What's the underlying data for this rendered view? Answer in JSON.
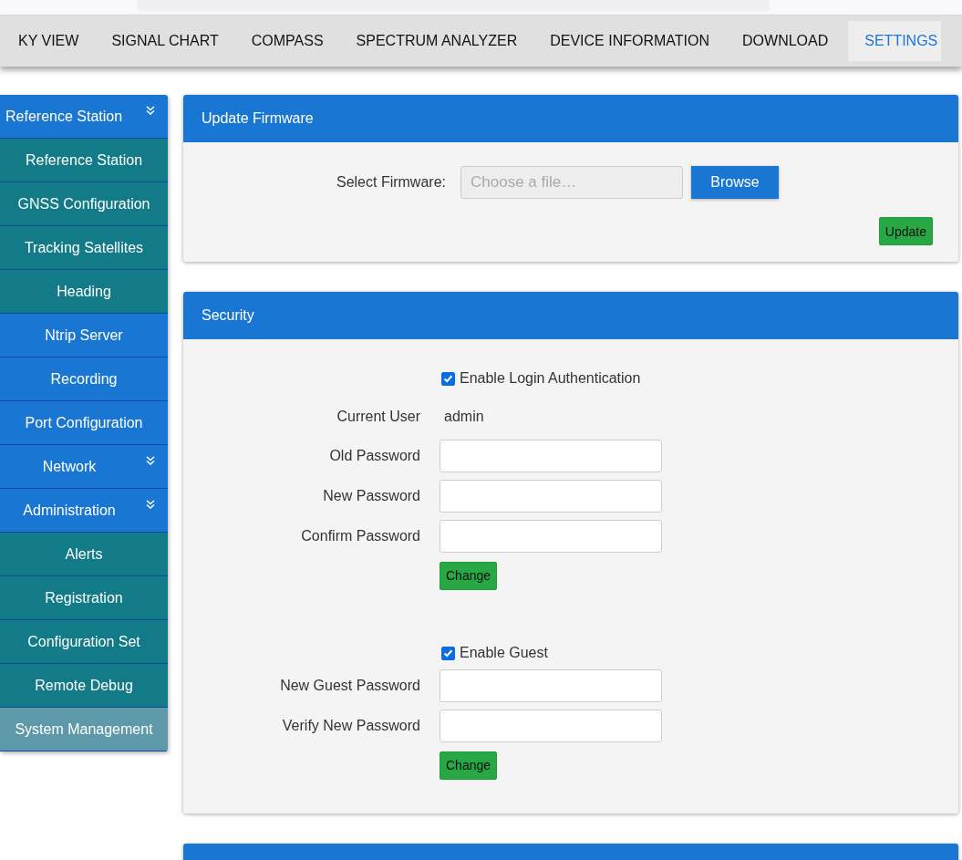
{
  "nav": {
    "tabs": [
      {
        "label": "KY VIEW",
        "selected": false
      },
      {
        "label": "SIGNAL CHART",
        "selected": false
      },
      {
        "label": "COMPASS",
        "selected": false
      },
      {
        "label": "SPECTRUM ANALYZER",
        "selected": false
      },
      {
        "label": "DEVICE INFORMATION",
        "selected": false
      },
      {
        "label": "DOWNLOAD",
        "selected": false
      },
      {
        "label": "SETTINGS",
        "selected": true
      }
    ]
  },
  "sidebar": {
    "items": [
      {
        "label": "Reference Station",
        "kind": "group",
        "selected": false
      },
      {
        "label": "Reference Station",
        "kind": "sub",
        "selected": false
      },
      {
        "label": "GNSS Configuration",
        "kind": "sub",
        "selected": false
      },
      {
        "label": "Tracking Satellites",
        "kind": "sub",
        "selected": false
      },
      {
        "label": "Heading",
        "kind": "sub",
        "selected": false
      },
      {
        "label": "Ntrip Server",
        "kind": "item",
        "selected": false
      },
      {
        "label": "Recording",
        "kind": "item",
        "selected": false
      },
      {
        "label": "Port Configuration",
        "kind": "item",
        "selected": false
      },
      {
        "label": "Network",
        "kind": "group",
        "selected": false
      },
      {
        "label": "Administration",
        "kind": "group",
        "selected": false
      },
      {
        "label": "Alerts",
        "kind": "sub",
        "selected": false
      },
      {
        "label": "Registration",
        "kind": "sub",
        "selected": false
      },
      {
        "label": "Configuration Set",
        "kind": "sub",
        "selected": false
      },
      {
        "label": "Remote Debug",
        "kind": "sub",
        "selected": false
      },
      {
        "label": "System Management",
        "kind": "sub",
        "selected": true
      }
    ]
  },
  "firmware": {
    "title": "Update Firmware",
    "label": "Select Firmware:",
    "file": {
      "placeholder": "Choose a file…"
    },
    "browse": "Browse",
    "update": "Update"
  },
  "security": {
    "title": "Security",
    "login": {
      "label": "Enable Login Authentication",
      "checked": true
    },
    "current_user": {
      "label": "Current User",
      "value": "admin"
    },
    "login_fields": [
      {
        "label": "Old Password"
      },
      {
        "label": "New Password"
      },
      {
        "label": "Confirm Password"
      }
    ],
    "change": "Change",
    "guest": {
      "label": "Enable Guest",
      "checked": true
    },
    "guest_fields": [
      {
        "label": "New Guest Password"
      },
      {
        "label": "Verify New Password"
      }
    ],
    "guest_change": "Change"
  }
}
